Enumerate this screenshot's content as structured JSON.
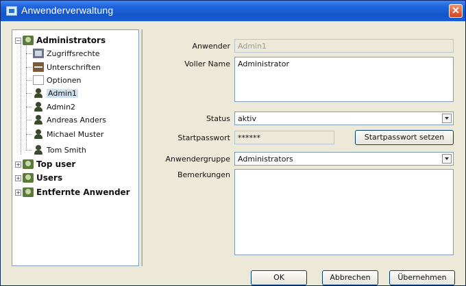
{
  "window": {
    "title": "Anwenderverwaltung",
    "close_glyph": "✕"
  },
  "tree": {
    "groups": [
      {
        "label": "Administrators",
        "icon": "group-icon",
        "expanded": true,
        "children": [
          {
            "label": "Zugriffsrechte",
            "icon": "permissions-icon"
          },
          {
            "label": "Unterschriften",
            "icon": "signature-icon"
          },
          {
            "label": "Optionen",
            "icon": "options-icon"
          },
          {
            "label": "Admin1",
            "icon": "user-icon",
            "selected": true
          },
          {
            "label": "Admin2",
            "icon": "user-icon"
          },
          {
            "label": "Andreas Anders",
            "icon": "user-icon"
          },
          {
            "label": "Michael Muster",
            "icon": "user-icon"
          },
          {
            "label": "Tom Smith",
            "icon": "user-icon"
          }
        ]
      },
      {
        "label": "Top user",
        "icon": "group-icon",
        "expanded": false
      },
      {
        "label": "Users",
        "icon": "group-icon",
        "expanded": false
      },
      {
        "label": "Entfernte Anwender",
        "icon": "group-icon",
        "expanded": false
      }
    ]
  },
  "form": {
    "anwender_label": "Anwender",
    "anwender_value": "Admin1",
    "vollername_label": "Voller Name",
    "vollername_value": "Administrator",
    "status_label": "Status",
    "status_value": "aktiv",
    "startpasswort_label": "Startpasswort",
    "startpasswort_value": "******",
    "startpasswort_button": "Startpasswort setzen",
    "anwendergruppe_label": "Anwendergruppe",
    "anwendergruppe_value": "Administrators",
    "bemerkungen_label": "Bemerkungen",
    "bemerkungen_value": ""
  },
  "buttons": {
    "ok": "OK",
    "abbrechen": "Abbrechen",
    "uebernehmen": "Übernehmen"
  },
  "colors": {
    "title_bar": "#1456c9",
    "close_button": "#d6421c",
    "selection": "#cfe0ef"
  }
}
